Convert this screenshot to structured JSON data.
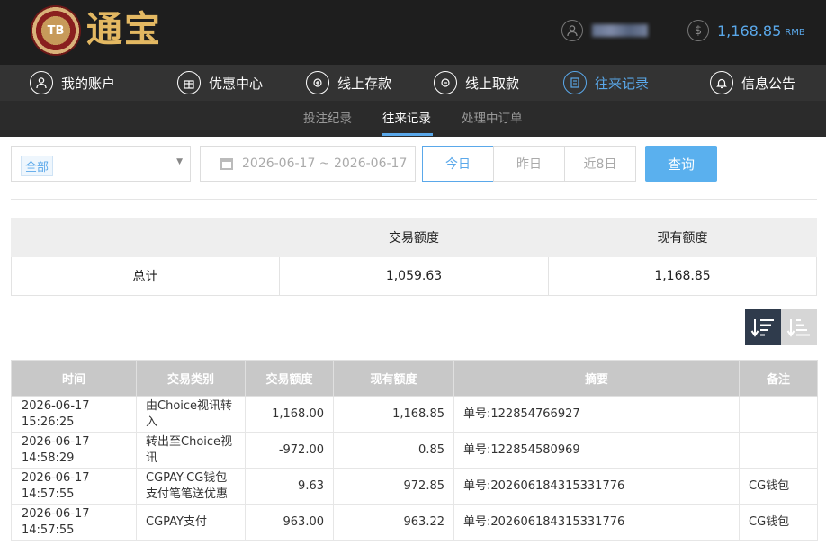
{
  "header": {
    "logo_badge": "TB",
    "logo_text": "通宝",
    "balance": "1,168.85",
    "balance_unit": "RMB"
  },
  "nav": {
    "items": [
      {
        "label": "我的账户",
        "icon": "user-icon"
      },
      {
        "label": "优惠中心",
        "icon": "gift-icon"
      },
      {
        "label": "线上存款",
        "icon": "deposit-icon"
      },
      {
        "label": "线上取款",
        "icon": "withdraw-icon"
      },
      {
        "label": "往来记录",
        "icon": "records-icon"
      },
      {
        "label": "信息公告",
        "icon": "bell-icon"
      }
    ],
    "active_index": 4
  },
  "subnav": {
    "items": [
      "投注纪录",
      "往来记录",
      "处理中订单"
    ],
    "active_index": 1
  },
  "filter": {
    "type_selected": "全部",
    "date_range": "2026-06-17 ~ 2026-06-17",
    "quick": [
      "今日",
      "昨日",
      "近8日"
    ],
    "quick_active_index": 0,
    "query_label": "查询"
  },
  "summary": {
    "headers": [
      "",
      "交易额度",
      "现有额度"
    ],
    "row": [
      "总计",
      "1,059.63",
      "1,168.85"
    ]
  },
  "records": {
    "headers": [
      "时间",
      "交易类别",
      "交易额度",
      "现有额度",
      "摘要",
      "备注"
    ],
    "rows": [
      [
        "2026-06-17 15:26:25",
        "由Choice视讯转入",
        "1,168.00",
        "1,168.85",
        "单号:122854766927",
        ""
      ],
      [
        "2026-06-17 14:58:29",
        "转出至Choice视讯",
        "-972.00",
        "0.85",
        "单号:122854580969",
        ""
      ],
      [
        "2026-06-17 14:57:55",
        "CGPAY-CG钱包支付笔笔送优惠",
        "9.63",
        "972.85",
        "单号:202606184315331776",
        "CG钱包"
      ],
      [
        "2026-06-17 14:57:55",
        "CGPAY支付",
        "963.00",
        "963.22",
        "单号:202606184315331776",
        "CG钱包"
      ]
    ]
  },
  "colors": {
    "accent": "#5aa8ea",
    "header_bg": "#1e1e1e",
    "nav_bg": "#333333"
  }
}
